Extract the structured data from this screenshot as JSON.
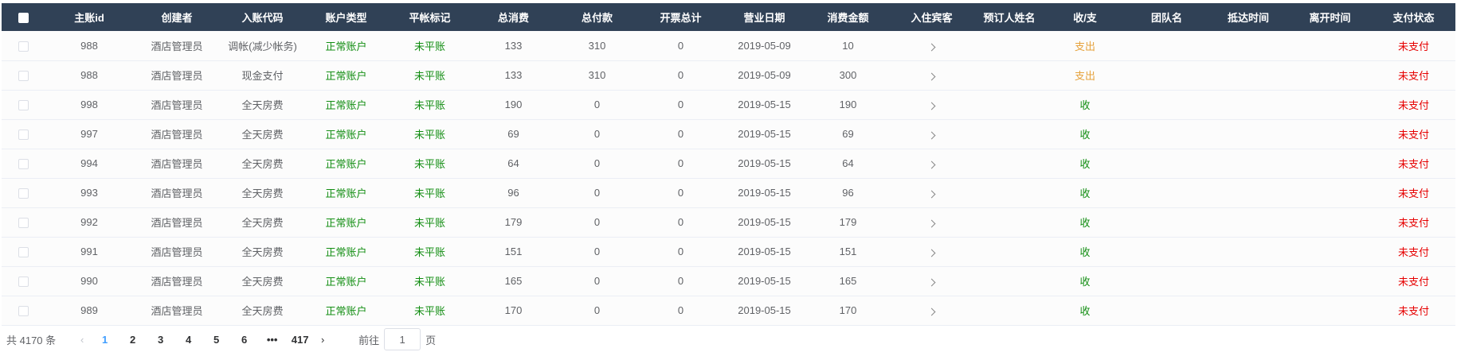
{
  "colors": {
    "header_bg": "#304156",
    "green": "#138e13",
    "orange": "#e6a23c",
    "red": "#e60000",
    "page_active": "#409eff"
  },
  "table": {
    "headers": [
      "",
      "主账id",
      "创建者",
      "入账代码",
      "账户类型",
      "平帐标记",
      "总消费",
      "总付款",
      "开票总计",
      "营业日期",
      "消费金额",
      "入住宾客",
      "预订人姓名",
      "收/支",
      "团队名",
      "抵达时间",
      "离开时间",
      "支付状态"
    ],
    "rows": [
      {
        "id": "988",
        "creator": "酒店管理员",
        "code": "调帐(减少帐务)",
        "acct_type": "正常账户",
        "flag": "未平账",
        "total_consume": "133",
        "total_pay": "310",
        "invoice": "0",
        "date": "2019-05-09",
        "amount": "10",
        "booker": "",
        "inout": "支出",
        "inout_type": "out",
        "team": "",
        "arrive": "",
        "leave": "",
        "status": "未支付"
      },
      {
        "id": "988",
        "creator": "酒店管理员",
        "code": "现金支付",
        "acct_type": "正常账户",
        "flag": "未平账",
        "total_consume": "133",
        "total_pay": "310",
        "invoice": "0",
        "date": "2019-05-09",
        "amount": "300",
        "booker": "",
        "inout": "支出",
        "inout_type": "out",
        "team": "",
        "arrive": "",
        "leave": "",
        "status": "未支付"
      },
      {
        "id": "998",
        "creator": "酒店管理员",
        "code": "全天房费",
        "acct_type": "正常账户",
        "flag": "未平账",
        "total_consume": "190",
        "total_pay": "0",
        "invoice": "0",
        "date": "2019-05-15",
        "amount": "190",
        "booker": "",
        "inout": "收",
        "inout_type": "in",
        "team": "",
        "arrive": "",
        "leave": "",
        "status": "未支付"
      },
      {
        "id": "997",
        "creator": "酒店管理员",
        "code": "全天房费",
        "acct_type": "正常账户",
        "flag": "未平账",
        "total_consume": "69",
        "total_pay": "0",
        "invoice": "0",
        "date": "2019-05-15",
        "amount": "69",
        "booker": "",
        "inout": "收",
        "inout_type": "in",
        "team": "",
        "arrive": "",
        "leave": "",
        "status": "未支付"
      },
      {
        "id": "994",
        "creator": "酒店管理员",
        "code": "全天房费",
        "acct_type": "正常账户",
        "flag": "未平账",
        "total_consume": "64",
        "total_pay": "0",
        "invoice": "0",
        "date": "2019-05-15",
        "amount": "64",
        "booker": "",
        "inout": "收",
        "inout_type": "in",
        "team": "",
        "arrive": "",
        "leave": "",
        "status": "未支付"
      },
      {
        "id": "993",
        "creator": "酒店管理员",
        "code": "全天房费",
        "acct_type": "正常账户",
        "flag": "未平账",
        "total_consume": "96",
        "total_pay": "0",
        "invoice": "0",
        "date": "2019-05-15",
        "amount": "96",
        "booker": "",
        "inout": "收",
        "inout_type": "in",
        "team": "",
        "arrive": "",
        "leave": "",
        "status": "未支付"
      },
      {
        "id": "992",
        "creator": "酒店管理员",
        "code": "全天房费",
        "acct_type": "正常账户",
        "flag": "未平账",
        "total_consume": "179",
        "total_pay": "0",
        "invoice": "0",
        "date": "2019-05-15",
        "amount": "179",
        "booker": "",
        "inout": "收",
        "inout_type": "in",
        "team": "",
        "arrive": "",
        "leave": "",
        "status": "未支付"
      },
      {
        "id": "991",
        "creator": "酒店管理员",
        "code": "全天房费",
        "acct_type": "正常账户",
        "flag": "未平账",
        "total_consume": "151",
        "total_pay": "0",
        "invoice": "0",
        "date": "2019-05-15",
        "amount": "151",
        "booker": "",
        "inout": "收",
        "inout_type": "in",
        "team": "",
        "arrive": "",
        "leave": "",
        "status": "未支付"
      },
      {
        "id": "990",
        "creator": "酒店管理员",
        "code": "全天房费",
        "acct_type": "正常账户",
        "flag": "未平账",
        "total_consume": "165",
        "total_pay": "0",
        "invoice": "0",
        "date": "2019-05-15",
        "amount": "165",
        "booker": "",
        "inout": "收",
        "inout_type": "in",
        "team": "",
        "arrive": "",
        "leave": "",
        "status": "未支付"
      },
      {
        "id": "989",
        "creator": "酒店管理员",
        "code": "全天房费",
        "acct_type": "正常账户",
        "flag": "未平账",
        "total_consume": "170",
        "total_pay": "0",
        "invoice": "0",
        "date": "2019-05-15",
        "amount": "170",
        "booker": "",
        "inout": "收",
        "inout_type": "in",
        "team": "",
        "arrive": "",
        "leave": "",
        "status": "未支付"
      }
    ]
  },
  "pagination": {
    "total_label": "共 4170 条",
    "pages": [
      "1",
      "2",
      "3",
      "4",
      "5",
      "6",
      "•••",
      "417"
    ],
    "current_page": "1",
    "prev_icon": "chevron-left-icon",
    "next_icon": "chevron-right-icon",
    "goto_prefix": "前往",
    "goto_value": "1",
    "goto_suffix": "页"
  }
}
